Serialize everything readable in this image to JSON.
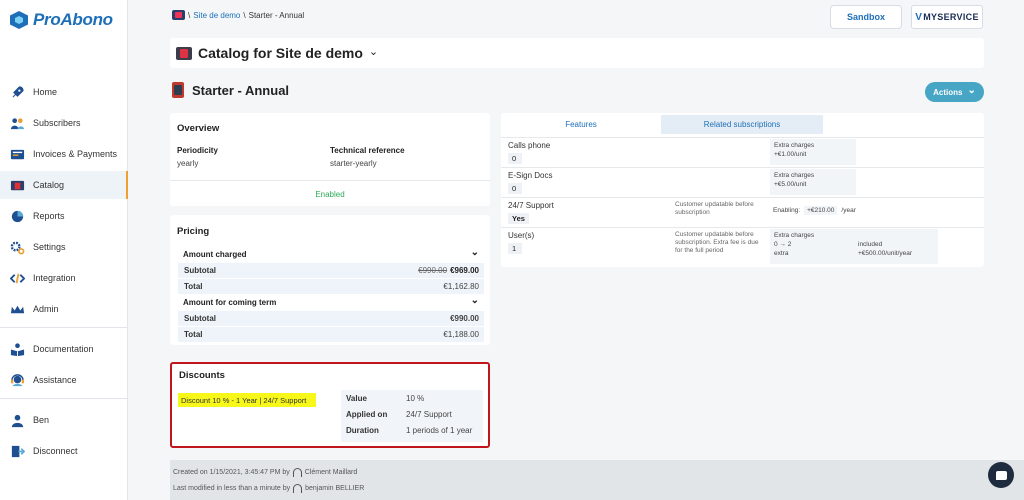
{
  "app": {
    "name": "ProAbono"
  },
  "sidebar": {
    "items": [
      {
        "label": "Home",
        "icon": "rocket-icon"
      },
      {
        "label": "Subscribers",
        "icon": "users-icon"
      },
      {
        "label": "Invoices & Payments",
        "icon": "invoices-icon"
      },
      {
        "label": "Catalog",
        "icon": "catalog-icon",
        "active": true
      },
      {
        "label": "Reports",
        "icon": "pie-chart-icon"
      },
      {
        "label": "Settings",
        "icon": "gear-icon"
      },
      {
        "label": "Integration",
        "icon": "code-icon"
      },
      {
        "label": "Admin",
        "icon": "crown-icon"
      },
      {
        "label": "Documentation",
        "icon": "book-icon"
      },
      {
        "label": "Assistance",
        "icon": "headset-icon"
      },
      {
        "label": "Ben",
        "icon": "user-icon"
      },
      {
        "label": "Disconnect",
        "icon": "logout-icon"
      }
    ]
  },
  "breadcrumb": {
    "site": "Site de demo",
    "sep1": "\\",
    "sep2": "\\",
    "current": "Starter - Annual"
  },
  "header": {
    "sandbox_label": "Sandbox",
    "account_logo_prefix": "V",
    "account_logo_text": "MYSERVICE"
  },
  "catalog": {
    "title": "Catalog for Site de demo",
    "chevron": "⌄"
  },
  "page": {
    "title": "Starter - Annual",
    "actions_label": "Actions",
    "actions_chevron": "⌄"
  },
  "overview": {
    "title": "Overview",
    "periodicity_label": "Periodicity",
    "periodicity_value": "yearly",
    "techref_label": "Technical reference",
    "techref_value": "starter-yearly",
    "status": "Enabled"
  },
  "pricing": {
    "title": "Pricing",
    "amount_charged_label": "Amount charged",
    "subtotal_label": "Subtotal",
    "subtotal_old": "€990.00",
    "subtotal_new": "€969.00",
    "total_label": "Total",
    "total_value": "€1,162.80",
    "coming_term_label": "Amount for coming term",
    "coming_subtotal_label": "Subtotal",
    "coming_subtotal_value": "€990.00",
    "coming_total_label": "Total",
    "coming_total_value": "€1,188.00",
    "expand_glyph": "⌄"
  },
  "discounts": {
    "title": "Discounts",
    "highlight": "Discount 10 % - 1 Year | 24/7 Support",
    "value_label": "Value",
    "value": "10 %",
    "applied_label": "Applied on",
    "applied": "24/7 Support",
    "duration_label": "Duration",
    "duration": "1 periods of 1 year"
  },
  "features": {
    "tabs": {
      "features": "Features",
      "related": "Related subscriptions"
    },
    "rows": [
      {
        "name": "Calls phone",
        "badge": "0",
        "charges_label": "Extra charges",
        "charges": "+€1.00/unit"
      },
      {
        "name": "E-Sign Docs",
        "badge": "0",
        "charges_label": "Extra charges",
        "charges": "+€5.00/unit"
      },
      {
        "name": "24/7 Support",
        "badge": "Yes",
        "note": "Customer updatable before subscription",
        "enabling_label": "Enabling:",
        "enabling_value": "+€210.00",
        "enabling_unit": "/year"
      },
      {
        "name": "User(s)",
        "badge": "1",
        "note": "Customer updatable before subscription. Extra fee is due for the full period",
        "charges_label": "Extra charges",
        "tier1_range": "0 → 2",
        "tier1_value": "included",
        "tier2_label": "extra",
        "tier2_value": "+€500.00/unit/year"
      }
    ]
  },
  "footer": {
    "created_prefix": "Created  on 1/15/2021, 3:45:47 PM   by",
    "created_by": "Clément Maillard",
    "modified_prefix": "Last modified  in less than a minute   by",
    "modified_by": "benjamin BELLIER"
  }
}
